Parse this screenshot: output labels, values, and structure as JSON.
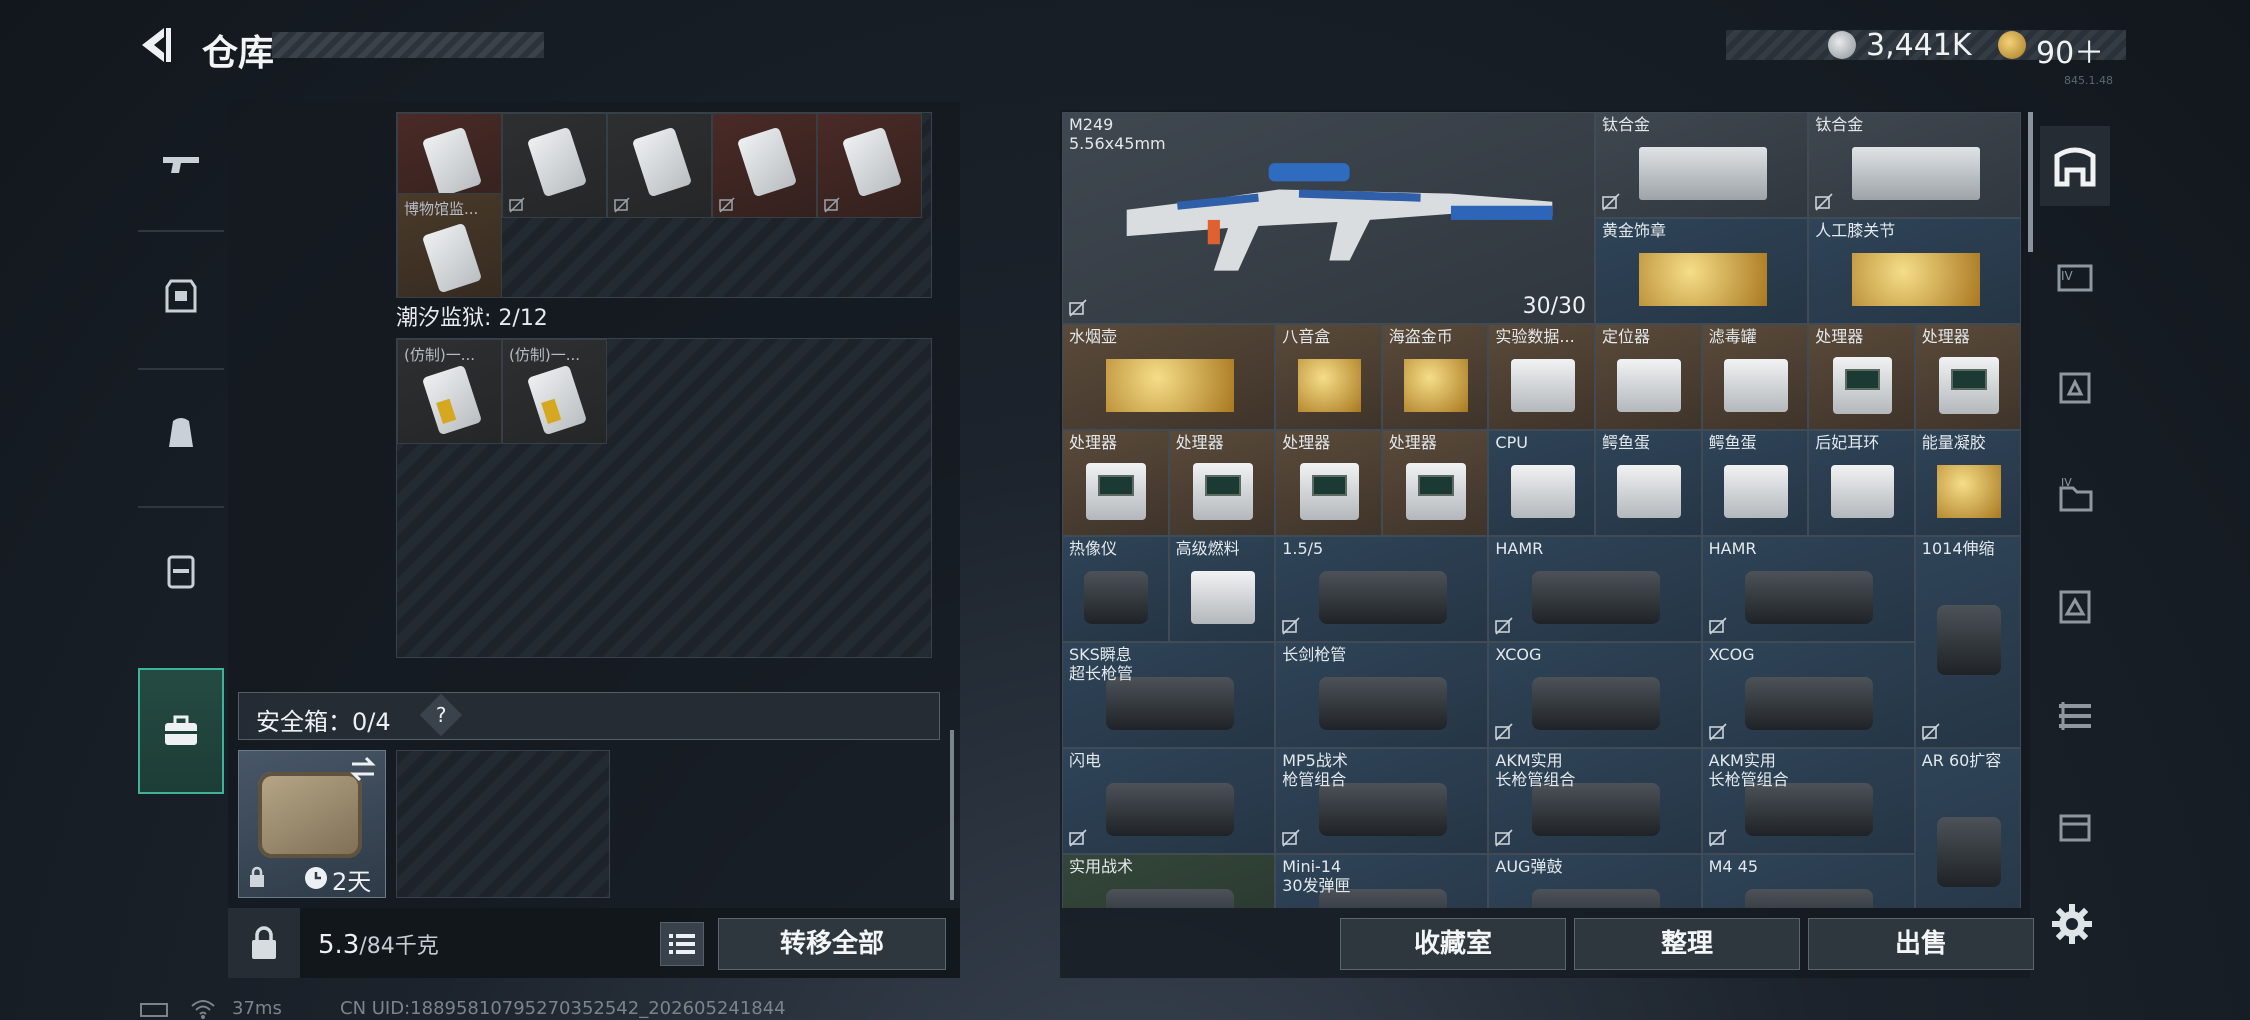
{
  "header": {
    "title": "仓库",
    "coins": "3,441K",
    "tickets": "90＋",
    "version": "845.1.48"
  },
  "left_rail": {
    "items": [
      "gun-icon",
      "backpack-icon",
      "bag-icon",
      "chest-rig-icon",
      "safebox-icon"
    ],
    "active": "safebox-icon"
  },
  "left_panel": {
    "upper_cells": [
      {
        "color": "red",
        "label": ""
      },
      {
        "color": "dark",
        "label": ""
      },
      {
        "color": "dark",
        "label": ""
      },
      {
        "color": "red",
        "label": ""
      },
      {
        "color": "red",
        "label": ""
      },
      {
        "color": "tan",
        "label": "博物馆监..."
      }
    ],
    "prison_label": "潮汐监狱: 2/12",
    "prison_cells": [
      {
        "label": "(仿制)一..."
      },
      {
        "label": "(仿制)一..."
      }
    ],
    "safebox_label": "安全箱：0/4",
    "safebox_help": "?",
    "safebox_days": "2天",
    "weight_current": "5.3",
    "weight_max": "/84千克",
    "transfer_all": "转移全部"
  },
  "inventory": {
    "items": [
      {
        "id": "m249",
        "label": "M249\n5.56x45mm",
        "count": "30/30",
        "bg": "gray",
        "pic": "gun"
      },
      {
        "id": "ti-1",
        "label": "钛合金",
        "bg": "gray",
        "pic": "bar"
      },
      {
        "id": "ti-2",
        "label": "钛合金",
        "bg": "gray",
        "pic": "bar"
      },
      {
        "id": "gold-badge",
        "label": "黄金饰章",
        "bg": "blue",
        "pic": "gold"
      },
      {
        "id": "knee-joint",
        "label": "人工膝关节",
        "bg": "blue",
        "pic": "gold"
      },
      {
        "id": "hookah",
        "label": "水烟壶",
        "bg": "brown",
        "pic": "gold"
      },
      {
        "id": "octant",
        "label": "八音盒",
        "bg": "brown",
        "pic": "gold"
      },
      {
        "id": "pirate-coin",
        "label": "海盗金币",
        "bg": "brown",
        "pic": "gold"
      },
      {
        "id": "lab-data",
        "label": "实验数据...",
        "bg": "brown",
        "pic": "box"
      },
      {
        "id": "locator",
        "label": "定位器",
        "bg": "brown",
        "pic": "box"
      },
      {
        "id": "filter-can",
        "label": "滤毒罐",
        "bg": "brown",
        "pic": "box"
      },
      {
        "id": "cpu-1",
        "label": "处理器",
        "bg": "brown",
        "pic": "proc"
      },
      {
        "id": "cpu-2",
        "label": "处理器",
        "bg": "brown",
        "pic": "proc"
      },
      {
        "id": "cpu-3",
        "label": "处理器",
        "bg": "brown",
        "pic": "proc"
      },
      {
        "id": "cpu-4",
        "label": "处理器",
        "bg": "brown",
        "pic": "proc"
      },
      {
        "id": "cpu-5",
        "label": "处理器",
        "bg": "brown",
        "pic": "proc"
      },
      {
        "id": "cpu-6",
        "label": "处理器",
        "bg": "brown",
        "pic": "proc"
      },
      {
        "id": "cpu-chip",
        "label": "CPU",
        "bg": "blue",
        "pic": "box"
      },
      {
        "id": "croc-egg-1",
        "label": "鳄鱼蛋",
        "bg": "blue",
        "pic": "box"
      },
      {
        "id": "croc-egg-2",
        "label": "鳄鱼蛋",
        "bg": "blue",
        "pic": "box"
      },
      {
        "id": "earring",
        "label": "后妃耳环",
        "bg": "blue",
        "pic": "box"
      },
      {
        "id": "energy-gel",
        "label": "能量凝胶",
        "bg": "blue",
        "pic": "gold"
      },
      {
        "id": "thermal",
        "label": "热像仪",
        "bg": "blue",
        "pic": "dark"
      },
      {
        "id": "fuel",
        "label": "高级燃料",
        "bg": "blue",
        "pic": "box"
      },
      {
        "id": "scope-15",
        "label": "1.5/5",
        "bg": "blue",
        "pic": "dark"
      },
      {
        "id": "hamr-1",
        "label": "HAMR",
        "bg": "blue",
        "pic": "dark"
      },
      {
        "id": "hamr-2",
        "label": "HAMR",
        "bg": "blue",
        "pic": "dark"
      },
      {
        "id": "stock-1014",
        "label": "1014伸缩",
        "bg": "blue",
        "pic": "dark"
      },
      {
        "id": "sks-barrel",
        "label": "SKS瞬息\n超长枪管",
        "bg": "blue",
        "pic": "dark"
      },
      {
        "id": "long-barrel",
        "label": "长剑枪管",
        "bg": "blue",
        "pic": "dark"
      },
      {
        "id": "xcog-1",
        "label": "XCOG",
        "bg": "blue",
        "pic": "dark"
      },
      {
        "id": "xcog-2",
        "label": "XCOG",
        "bg": "blue",
        "pic": "dark"
      },
      {
        "id": "flash-stock",
        "label": "闪电",
        "bg": "blue",
        "pic": "dark"
      },
      {
        "id": "mp5-kit",
        "label": "MP5战术\n枪管组合",
        "bg": "blue",
        "pic": "dark"
      },
      {
        "id": "akm-kit-1",
        "label": "AKM实用\n长枪管组合",
        "bg": "blue",
        "pic": "dark"
      },
      {
        "id": "akm-kit-2",
        "label": "AKM实用\n长枪管组合",
        "bg": "blue",
        "pic": "dark"
      },
      {
        "id": "ar60-mag",
        "label": "AR 60扩容",
        "bg": "blue",
        "pic": "dark"
      },
      {
        "id": "tactical",
        "label": "实用战术",
        "bg": "green",
        "pic": "dark"
      },
      {
        "id": "mini14",
        "label": "Mini-14\n30发弹匣",
        "bg": "blue",
        "pic": "dark"
      },
      {
        "id": "aug-drum",
        "label": "AUG弹鼓",
        "bg": "blue",
        "pic": "dark"
      },
      {
        "id": "m4-45",
        "label": "M4 45",
        "bg": "blue",
        "pic": "dark"
      }
    ]
  },
  "bottom_buttons": {
    "collection": "收藏室",
    "organize": "整理",
    "sell": "出售"
  },
  "right_toolbar": [
    "vault-icon",
    "level4-helmet-icon",
    "armor-icon",
    "level4-rig-icon",
    "armor2-icon",
    "rifle-rack-icon",
    "crate-icon"
  ],
  "status": {
    "ping": "37ms",
    "uid": "CN UID:18895810795270352542_202605241844"
  },
  "colors": {
    "accent": "#3fb29a",
    "gold": "#d6a820"
  }
}
